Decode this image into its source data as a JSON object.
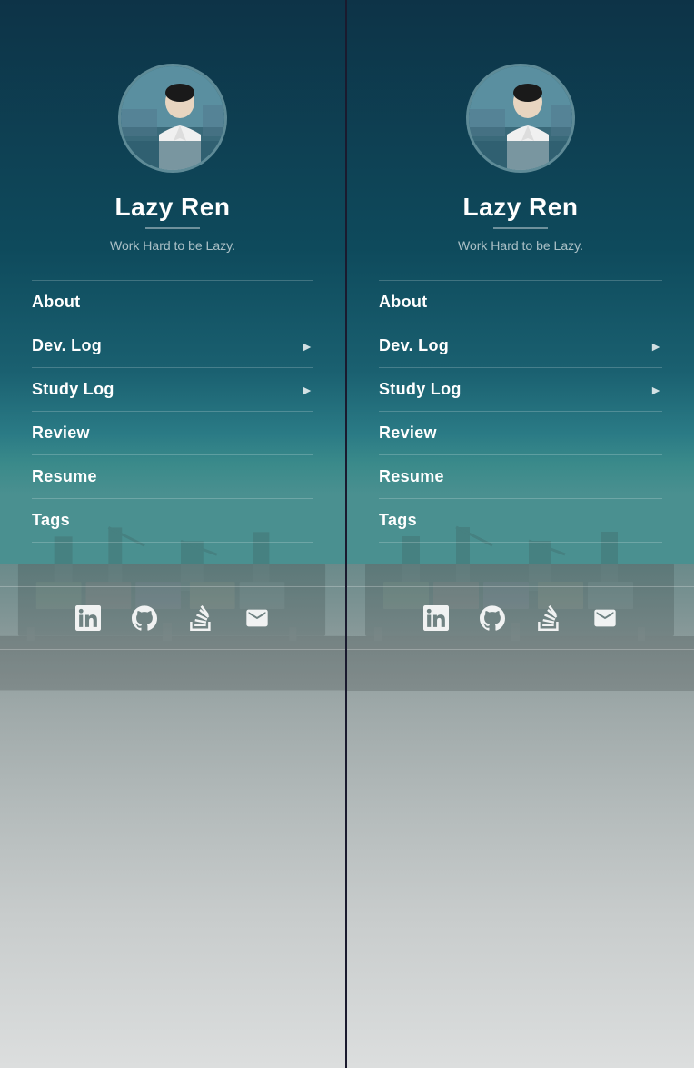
{
  "panels": [
    {
      "id": "left",
      "profile": {
        "name": "Lazy Ren",
        "tagline": "Work Hard to be Lazy."
      },
      "nav": [
        {
          "label": "About",
          "hasArrow": false
        },
        {
          "label": "Dev. Log",
          "hasArrow": true
        },
        {
          "label": "Study Log",
          "hasArrow": true
        },
        {
          "label": "Review",
          "hasArrow": false
        },
        {
          "label": "Resume",
          "hasArrow": false
        },
        {
          "label": "Tags",
          "hasArrow": false
        }
      ],
      "social": [
        {
          "name": "linkedin",
          "title": "LinkedIn"
        },
        {
          "name": "github",
          "title": "GitHub"
        },
        {
          "name": "stackoverflow",
          "title": "Stack Overflow"
        },
        {
          "name": "email",
          "title": "Email"
        }
      ]
    },
    {
      "id": "right",
      "profile": {
        "name": "Lazy Ren",
        "tagline": "Work Hard to be Lazy."
      },
      "nav": [
        {
          "label": "About",
          "hasArrow": false
        },
        {
          "label": "Dev. Log",
          "hasArrow": true
        },
        {
          "label": "Study Log",
          "hasArrow": true
        },
        {
          "label": "Review",
          "hasArrow": false
        },
        {
          "label": "Resume",
          "hasArrow": false
        },
        {
          "label": "Tags",
          "hasArrow": false
        }
      ],
      "social": [
        {
          "name": "linkedin",
          "title": "LinkedIn"
        },
        {
          "name": "github",
          "title": "GitHub"
        },
        {
          "name": "stackoverflow",
          "title": "Stack Overflow"
        },
        {
          "name": "email",
          "title": "Email"
        }
      ]
    }
  ]
}
